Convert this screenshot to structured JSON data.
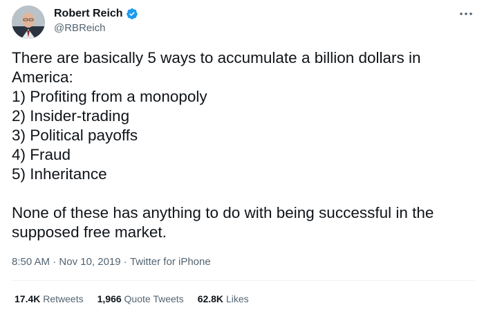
{
  "author": {
    "display_name": "Robert Reich",
    "handle": "@RBReich",
    "verified": true,
    "verified_color": "#1d9bf0"
  },
  "tweet": {
    "text": "There are basically 5 ways to accumulate a billion dollars in\nAmerica:\n1) Profiting from a monopoly\n2) Insider-trading\n3) Political payoffs\n4) Fraud\n5) Inheritance\n\nNone of these has anything to do with being successful in the\nsupposed free market."
  },
  "meta": {
    "time": "8:50 AM",
    "separator": " · ",
    "date": "Nov 10, 2019",
    "source": "Twitter for iPhone"
  },
  "stats": {
    "retweets_count": "17.4K",
    "retweets_label": "Retweets",
    "quote_count": "1,966",
    "quote_label": "Quote Tweets",
    "likes_count": "62.8K",
    "likes_label": "Likes"
  },
  "icons": {
    "verified": "verified-badge-icon",
    "more": "more-options-icon"
  },
  "colors": {
    "text_primary": "#0f1419",
    "text_secondary": "#536471",
    "divider": "#eff3f4"
  }
}
